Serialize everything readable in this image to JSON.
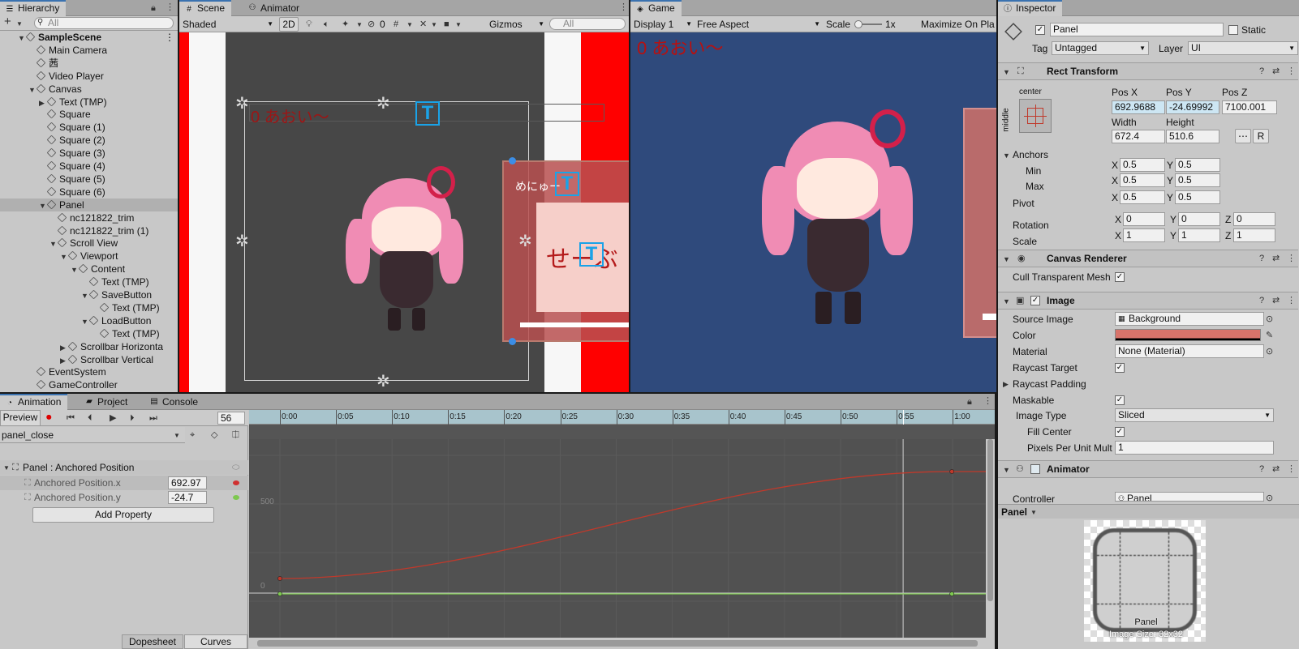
{
  "colors": {
    "accent": "#3a72b0",
    "red_line": "#c0392b",
    "green_line": "#7ec850",
    "game_bg": "#2f4a7c",
    "image_color": "#d9746b"
  },
  "hierarchy": {
    "tab": "Hierarchy",
    "search_placeholder": "All",
    "items": [
      {
        "label": "SampleScene",
        "depth": 0,
        "arrow": "▼",
        "bold": true
      },
      {
        "label": "Main Camera",
        "depth": 1,
        "arrow": ""
      },
      {
        "label": "茜",
        "depth": 1,
        "arrow": ""
      },
      {
        "label": "Video Player",
        "depth": 1,
        "arrow": ""
      },
      {
        "label": "Canvas",
        "depth": 1,
        "arrow": "▼"
      },
      {
        "label": "Text (TMP)",
        "depth": 2,
        "arrow": "▶"
      },
      {
        "label": "Square",
        "depth": 2,
        "arrow": ""
      },
      {
        "label": "Square (1)",
        "depth": 2,
        "arrow": ""
      },
      {
        "label": "Square (2)",
        "depth": 2,
        "arrow": ""
      },
      {
        "label": "Square (3)",
        "depth": 2,
        "arrow": ""
      },
      {
        "label": "Square (4)",
        "depth": 2,
        "arrow": ""
      },
      {
        "label": "Square (5)",
        "depth": 2,
        "arrow": ""
      },
      {
        "label": "Square (6)",
        "depth": 2,
        "arrow": ""
      },
      {
        "label": "Panel",
        "depth": 2,
        "arrow": "▼",
        "selected": true
      },
      {
        "label": "nc121822_trim",
        "depth": 3,
        "arrow": ""
      },
      {
        "label": "nc121822_trim (1)",
        "depth": 3,
        "arrow": ""
      },
      {
        "label": "Scroll View",
        "depth": 3,
        "arrow": "▼"
      },
      {
        "label": "Viewport",
        "depth": 4,
        "arrow": "▼"
      },
      {
        "label": "Content",
        "depth": 5,
        "arrow": "▼"
      },
      {
        "label": "Text (TMP)",
        "depth": 6,
        "arrow": ""
      },
      {
        "label": "SaveButton",
        "depth": 6,
        "arrow": "▼"
      },
      {
        "label": "Text (TMP)",
        "depth": 7,
        "arrow": ""
      },
      {
        "label": "LoadButton",
        "depth": 6,
        "arrow": "▼"
      },
      {
        "label": "Text (TMP)",
        "depth": 7,
        "arrow": ""
      },
      {
        "label": "Scrollbar Horizonta",
        "depth": 4,
        "arrow": "▶"
      },
      {
        "label": "Scrollbar Vertical",
        "depth": 4,
        "arrow": "▶"
      },
      {
        "label": "EventSystem",
        "depth": 1,
        "arrow": ""
      },
      {
        "label": "GameController",
        "depth": 1,
        "arrow": ""
      }
    ]
  },
  "scene": {
    "tab": "Scene",
    "tab2": "Animator",
    "shading": "Shaded",
    "mode2d": "2D",
    "hidden_count": "0",
    "gizmos": "Gizmos",
    "search_placeholder": "All",
    "text_label": "0 あおい～",
    "menu_text": "めにゅー",
    "save_text": "せーぶ"
  },
  "game": {
    "tab": "Game",
    "display": "Display 1",
    "aspect": "Free Aspect",
    "scale_label": "Scale",
    "scale_value": "1x",
    "maximize": "Maximize On Pla",
    "text_label": "0 あおい～"
  },
  "inspector": {
    "tab": "Inspector",
    "name": "Panel",
    "static_label": "Static",
    "tag_label": "Tag",
    "tag_value": "Untagged",
    "layer_label": "Layer",
    "layer_value": "UI",
    "rect": {
      "title": "Rect Transform",
      "anchor_preset_top": "center",
      "anchor_preset_side": "middle",
      "posx_label": "Pos X",
      "posy_label": "Pos Y",
      "posz_label": "Pos Z",
      "posx": "692.9688",
      "posy": "-24.69992",
      "posz": "7100.001",
      "width_label": "Width",
      "height_label": "Height",
      "width": "672.4",
      "height": "510.6",
      "r_btn": "R",
      "anchors_label": "Anchors",
      "min_label": "Min",
      "max_label": "Max",
      "pivot_label": "Pivot",
      "rotation_label": "Rotation",
      "scale_label": "Scale",
      "x": "X",
      "y": "Y",
      "z": "Z",
      "min_x": "0.5",
      "min_y": "0.5",
      "max_x": "0.5",
      "max_y": "0.5",
      "pivot_x": "0.5",
      "pivot_y": "0.5",
      "rot_x": "0",
      "rot_y": "0",
      "rot_z": "0",
      "scale_x": "1",
      "scale_y": "1",
      "scale_z": "1"
    },
    "canvas_renderer": {
      "title": "Canvas Renderer",
      "cull_label": "Cull Transparent Mesh"
    },
    "image": {
      "title": "Image",
      "source_label": "Source Image",
      "source_value": "Background",
      "color_label": "Color",
      "material_label": "Material",
      "material_value": "None (Material)",
      "raycast_label": "Raycast Target",
      "padding_label": "Raycast Padding",
      "maskable_label": "Maskable",
      "type_label": "Image Type",
      "type_value": "Sliced",
      "fill_label": "Fill Center",
      "ppu_label": "Pixels Per Unit Mult",
      "ppu_value": "1"
    },
    "animator": {
      "title": "Animator",
      "controller_label": "Controller",
      "controller_value": "Panel"
    },
    "preview": {
      "label": "Panel",
      "caption": "Panel",
      "size": "Image Size: 32x32"
    }
  },
  "animation": {
    "tabs": [
      "Animation",
      "Project",
      "Console"
    ],
    "preview_label": "Preview",
    "frame": "56",
    "clip": "panel_close",
    "property_group": "Panel : Anchored Position",
    "props": [
      {
        "label": "Anchored Position.x",
        "value": "692.97"
      },
      {
        "label": "Anchored Position.y",
        "value": "-24.7"
      }
    ],
    "add_property": "Add Property",
    "bottom_tabs": [
      "Dopesheet",
      "Curves"
    ],
    "timeline": [
      "0:00",
      "0:05",
      "0:10",
      "0:15",
      "0:20",
      "0:25",
      "0:30",
      "0:35",
      "0:40",
      "0:45",
      "0:50",
      "0:55",
      "1:00"
    ],
    "y_labels": [
      "500",
      "0"
    ]
  }
}
